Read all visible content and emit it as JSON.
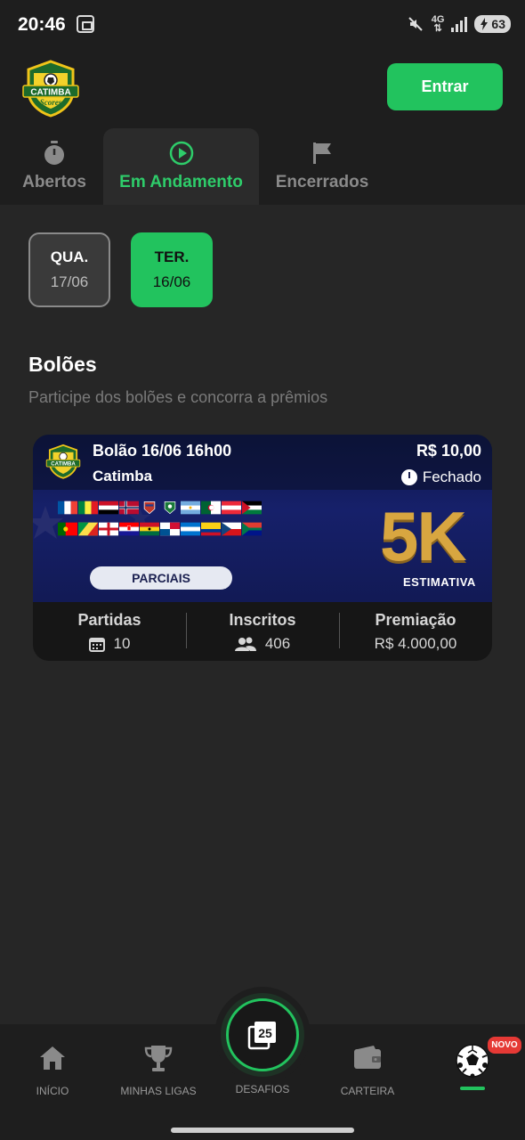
{
  "status_bar": {
    "time": "20:46",
    "network": "4G",
    "battery": "63"
  },
  "header": {
    "logo_text": "CATIMBA",
    "logo_subtext": "Scores",
    "login_label": "Entrar"
  },
  "tabs": [
    {
      "label": "Abertos",
      "icon": "stopwatch-icon",
      "active": false
    },
    {
      "label": "Em Andamento",
      "icon": "play-circle-icon",
      "active": true
    },
    {
      "label": "Encerrados",
      "icon": "flag-icon",
      "active": false
    }
  ],
  "dates": [
    {
      "day": "QUA.",
      "date": "17/06",
      "selected": false
    },
    {
      "day": "TER.",
      "date": "16/06",
      "selected": true
    }
  ],
  "section": {
    "title": "Bolões",
    "subtitle": "Participe dos bolões e concorra a prêmios"
  },
  "card": {
    "title": "Bolão 16/06 16h00",
    "organizer": "Catimba",
    "price": "R$ 10,00",
    "status": "Fechado",
    "prize_headline": "5K",
    "prize_caption": "ESTIMATIVA",
    "partials_label": "PARCIAIS",
    "stats": {
      "matches_label": "Partidas",
      "matches_value": "10",
      "entrants_label": "Inscritos",
      "entrants_value": "406",
      "prize_label": "Premiação",
      "prize_value": "R$ 4.000,00"
    }
  },
  "bottom_nav": {
    "home": "INÍCIO",
    "leagues": "MINHAS LIGAS",
    "challenges": "DESAFIOS",
    "challenges_icon_number": "25",
    "wallet": "CARTEIRA",
    "new_badge": "NOVO"
  },
  "colors": {
    "accent": "#22c35e",
    "background": "#262626",
    "card_blue": "#16206a",
    "gold": "#d8a640",
    "badge_red": "#e53935"
  }
}
